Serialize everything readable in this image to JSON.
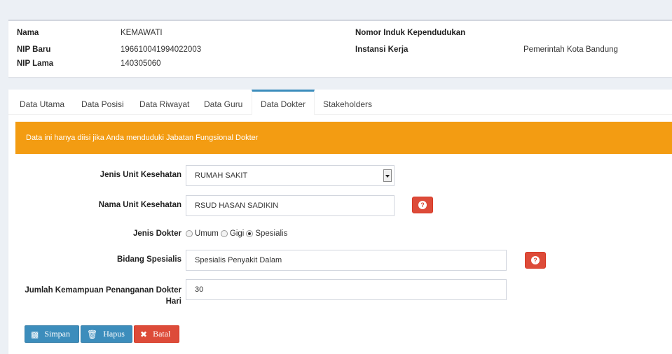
{
  "profile": {
    "nama_label": "Nama",
    "nama_value": "KEMAWATI",
    "nip_baru_label": "NIP Baru",
    "nip_baru_value": "196610041994022003",
    "nip_lama_label": "NIP Lama",
    "nip_lama_value": "140305060",
    "nik_label": "Nomor Induk Kependudukan",
    "nik_value": "",
    "instansi_label": "Instansi Kerja",
    "instansi_value": "Pemerintah Kota Bandung"
  },
  "tabs": [
    {
      "label": "Data Utama",
      "active": false
    },
    {
      "label": "Data Posisi",
      "active": false
    },
    {
      "label": "Data Riwayat",
      "active": false
    },
    {
      "label": "Data Guru",
      "active": false
    },
    {
      "label": "Data Dokter",
      "active": true
    },
    {
      "label": "Stakeholders",
      "active": false
    }
  ],
  "alert": {
    "text": "Data ini hanya diisi jika Anda menduduki Jabatan Fungsional Dokter"
  },
  "form": {
    "jenis_unit_label": "Jenis Unit Kesehatan",
    "jenis_unit_value": "RUMAH SAKIT",
    "nama_unit_label": "Nama Unit Kesehatan",
    "nama_unit_value": "RSUD HASAN SADIKIN",
    "jenis_dokter_label": "Jenis Dokter",
    "jenis_dokter_options": [
      "Umum",
      "Gigi",
      "Spesialis"
    ],
    "jenis_dokter_selected": "Spesialis",
    "bidang_label": "Bidang Spesialis",
    "bidang_value": "Spesialis Penyakit Dalam",
    "jumlah_label_line1": "Jumlah Kemampuan Penanganan Dokter",
    "jumlah_label_line2": "Hari",
    "jumlah_value": "30"
  },
  "buttons": {
    "save": "Simpan",
    "delete": "Hapus",
    "cancel": "Batal"
  },
  "colors": {
    "primary": "#3c8dbc",
    "danger": "#dd4b39",
    "warning": "#f39c12"
  }
}
